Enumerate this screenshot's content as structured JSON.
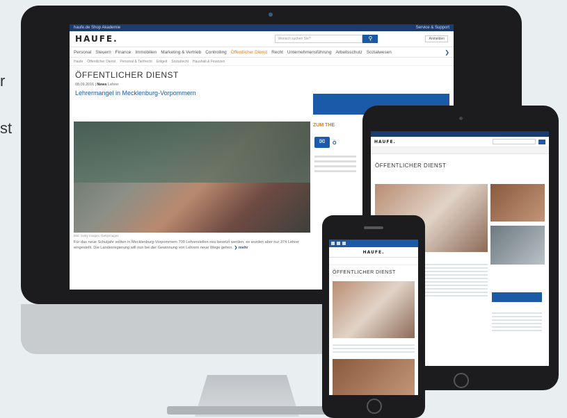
{
  "left_edge": {
    "fragment_1": "r",
    "fragment_2": "st"
  },
  "desktop": {
    "topbar_left": "haufe.de  Shop  Akademie",
    "topbar_right": "Service & Support",
    "logo": "HAUFE.",
    "search_placeholder": "Wonach suchen Sie?",
    "search_button_icon": "search-icon",
    "login_label": "Anmelden",
    "nav": [
      {
        "label": "Personal"
      },
      {
        "label": "Steuern"
      },
      {
        "label": "Finance"
      },
      {
        "label": "Immobilien"
      },
      {
        "label": "Marketing & Vertrieb"
      },
      {
        "label": "Controlling"
      },
      {
        "label": "Öffentlicher Dienst",
        "active": true
      },
      {
        "label": "Recht"
      },
      {
        "label": "Unternehmensführung"
      },
      {
        "label": "Arbeitsschutz"
      },
      {
        "label": "Sozialwesen"
      }
    ],
    "subnav": [
      "Haufe",
      "Öffentlicher Dienst",
      "Personal & Tarifrecht",
      "Entgelt",
      "Sozialrecht",
      "Haushalt & Finanzen"
    ],
    "page_title": "ÖFFENTLICHER DIENST",
    "article_date": "08.09.2016",
    "article_tag": "News",
    "article_category": "Lehrer",
    "headline": "Lehrermangel in Mecklenburg-Vorpommern",
    "image_caption": "Bild: Getty Images, Gettyimages",
    "teaser": "Für das neue Schuljahr sollten in Mecklenburg-Vorpommern 700 Lehrerstellen neu besetzt werden, es wurden aber nur 374 Lehrer eingestellt. Die Landesregierung will nun bei der Gewinnung von Lehrern neue Wege gehen.",
    "more_link": "mehr",
    "sidebar_heading": "ZUM THE",
    "sidebar_label": "Ö"
  },
  "tablet": {
    "logo": "HAUFE.",
    "page_title": "ÖFFENTLICHER DIENST"
  },
  "phone": {
    "logo": "HAUFE.",
    "page_title": "ÖFFENTLICHER DIENST"
  },
  "colors": {
    "brand_blue": "#1a5aa7",
    "accent_orange": "#e77b1c",
    "device_black": "#1c1c1e"
  }
}
